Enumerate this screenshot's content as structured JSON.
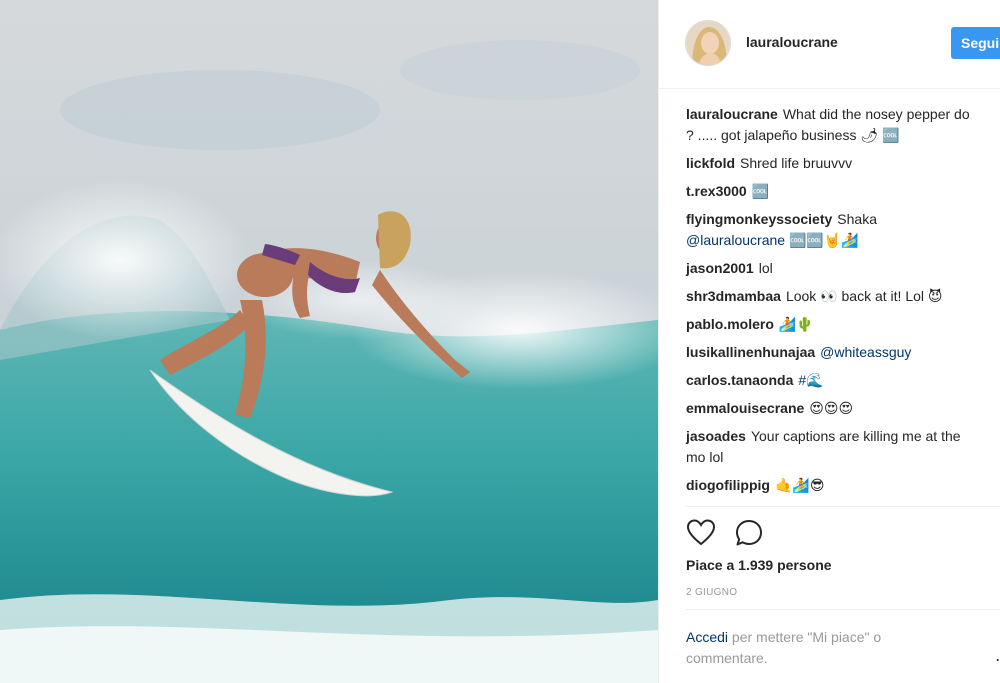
{
  "post": {
    "author": "lauraloucrane",
    "follow_label": "Segui"
  },
  "comments": [
    {
      "user": "lauraloucrane",
      "text": "What did the nosey pepper do",
      "text2": "? ..... got jalapeño business 🌶 🆒",
      "mention": ""
    },
    {
      "user": "lickfold",
      "text": "Shred life bruuvvv",
      "mention": ""
    },
    {
      "user": "t.rex3000",
      "text": "🆒",
      "mention": ""
    },
    {
      "user": "flyingmonkeyssociety",
      "text": "Shaka",
      "mention": "@lauraloucrane",
      "after": "🆒🆒🤘🏄"
    },
    {
      "user": "jason2001",
      "text": "lol",
      "mention": ""
    },
    {
      "user": "shr3dmambaa",
      "text": "Look 👀 back at it! Lol 😈",
      "mention": ""
    },
    {
      "user": "pablo.molero",
      "text": "🏄🌵",
      "mention": ""
    },
    {
      "user": "lusikallinenhunajaa",
      "text": "",
      "mention": "@whiteassguy"
    },
    {
      "user": "carlos.tanaonda",
      "text": "",
      "mention": "#🌊"
    },
    {
      "user": "emmalouisecrane",
      "text": "😍😍😍",
      "mention": ""
    },
    {
      "user": "jasoades",
      "text": "Your captions are killing me at the",
      "text2": "mo lol",
      "mention": ""
    },
    {
      "user": "diogofilippig",
      "text": "🤙🏄😎",
      "mention": ""
    }
  ],
  "actions": {
    "like_icon": "heart-icon",
    "comment_icon": "comment-icon"
  },
  "likes_text": "Piace a 1.939 persone",
  "date_text": "2 GIUGNO",
  "login": {
    "link": "Accedi",
    "text": " per mettere \"Mi piace\" o commentare."
  },
  "colors": {
    "accent": "#3897f0",
    "link": "#003569",
    "muted": "#999999"
  }
}
